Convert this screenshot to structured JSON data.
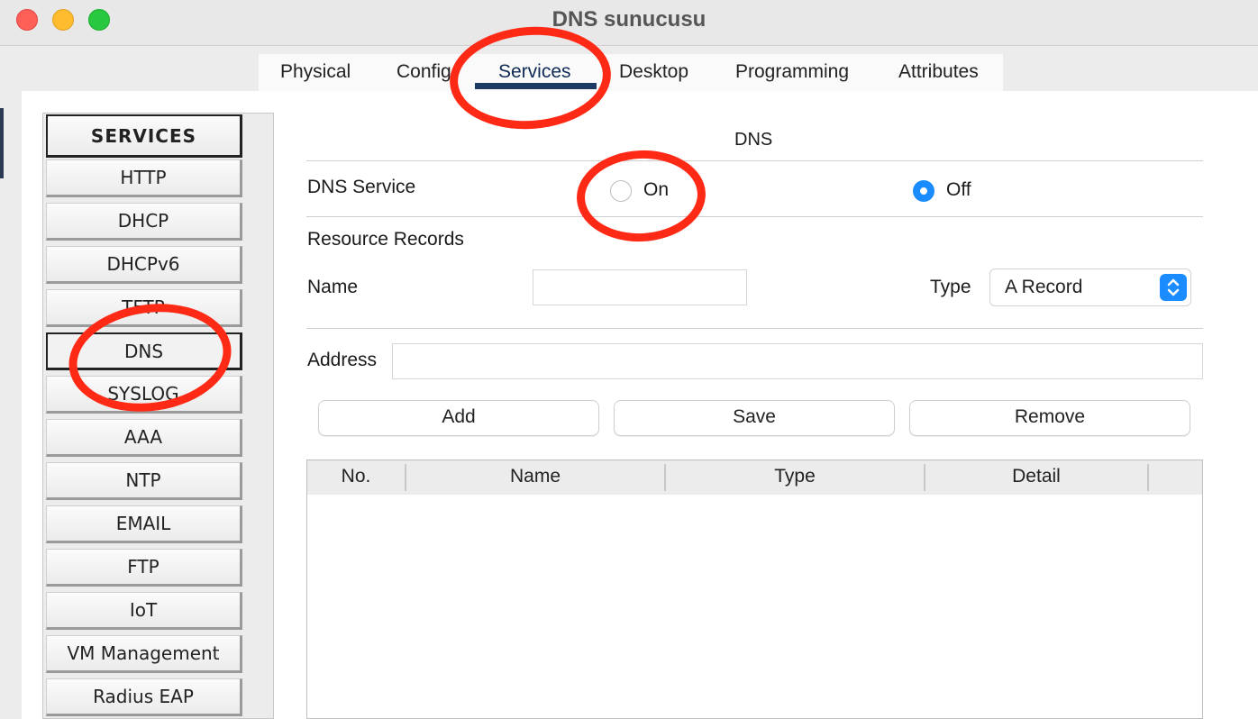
{
  "window": {
    "title": "DNS sunucusu"
  },
  "tabs": [
    {
      "label": "Physical",
      "active": false
    },
    {
      "label": "Config",
      "active": false
    },
    {
      "label": "Services",
      "active": true
    },
    {
      "label": "Desktop",
      "active": false
    },
    {
      "label": "Programming",
      "active": false
    },
    {
      "label": "Attributes",
      "active": false
    }
  ],
  "services": {
    "header": "SERVICES",
    "items": [
      "HTTP",
      "DHCP",
      "DHCPv6",
      "TFTP",
      "DNS",
      "SYSLOG",
      "AAA",
      "NTP",
      "EMAIL",
      "FTP",
      "IoT",
      "VM Management",
      "Radius EAP"
    ],
    "selected": "DNS"
  },
  "dns": {
    "section_title": "DNS",
    "service_label": "DNS Service",
    "on_label": "On",
    "off_label": "Off",
    "service_state": "Off",
    "resource_records_label": "Resource Records",
    "name_label": "Name",
    "name_value": "",
    "type_label": "Type",
    "type_value": "A Record",
    "address_label": "Address",
    "address_value": "",
    "add_button": "Add",
    "save_button": "Save",
    "remove_button": "Remove",
    "table_columns": [
      "No.",
      "Name",
      "Type",
      "Detail"
    ],
    "table_rows": []
  },
  "colors": {
    "accent": "#1a8cff",
    "annotation": "#ff2a16",
    "tab_underline": "#1d3a63"
  },
  "icons": {
    "close": "close-dot-icon",
    "minimize": "minimize-dot-icon",
    "zoom": "zoom-dot-icon",
    "select": "updown-chevron-icon"
  }
}
